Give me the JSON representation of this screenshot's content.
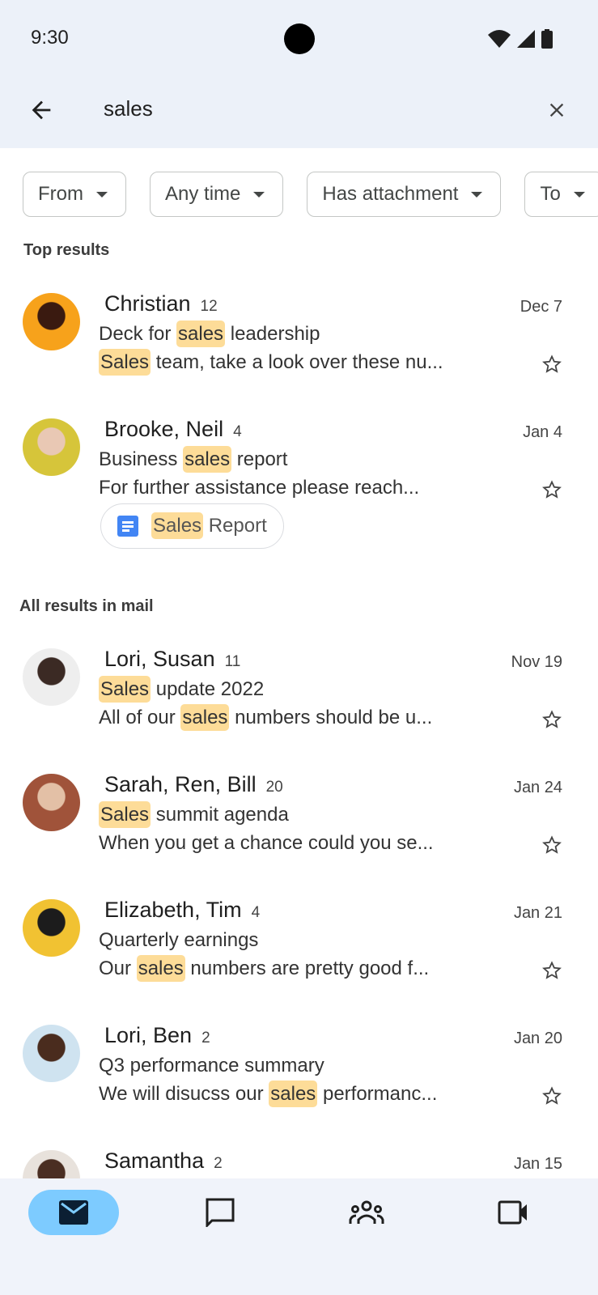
{
  "status_bar": {
    "time": "9:30"
  },
  "search": {
    "query": "sales"
  },
  "filters": [
    {
      "label": "From"
    },
    {
      "label": "Any time"
    },
    {
      "label": "Has attachment"
    },
    {
      "label": "To"
    }
  ],
  "sections": {
    "top": "Top results",
    "all": "All results in mail"
  },
  "highlight_color": "#fddc98",
  "top_results": [
    {
      "sender": "Christian",
      "count": "12",
      "date": "Dec 7",
      "avatar_colors": [
        "#f7a21b",
        "#3a1a10"
      ],
      "subject": [
        {
          "t": "Deck for "
        },
        {
          "t": "sales",
          "hl": true
        },
        {
          "t": " leadership"
        }
      ],
      "preview": [
        {
          "t": "Sales",
          "hl": true
        },
        {
          "t": " team, take a look over these nu..."
        }
      ]
    },
    {
      "sender": "Brooke, Neil",
      "count": "4",
      "date": "Jan 4",
      "avatar_colors": [
        "#d6c53a",
        "#e9c8b4"
      ],
      "subject": [
        {
          "t": "Business "
        },
        {
          "t": "sales",
          "hl": true
        },
        {
          "t": " report"
        }
      ],
      "preview": [
        {
          "t": "For further assistance please reach..."
        }
      ],
      "attachment": [
        {
          "t": "Sales",
          "hl": true
        },
        {
          "t": " Report"
        }
      ]
    }
  ],
  "all_results": [
    {
      "sender": "Lori, Susan",
      "count": "11",
      "date": "Nov 19",
      "avatar_colors": [
        "#eeeeee",
        "#3b2a24"
      ],
      "subject": [
        {
          "t": "Sales",
          "hl": true
        },
        {
          "t": " update 2022"
        }
      ],
      "preview": [
        {
          "t": "All of our "
        },
        {
          "t": "sales",
          "hl": true
        },
        {
          "t": " numbers should be u..."
        }
      ]
    },
    {
      "sender": "Sarah, Ren, Bill",
      "count": "20",
      "date": "Jan 24",
      "avatar_colors": [
        "#a0533a",
        "#e3c0a6"
      ],
      "subject": [
        {
          "t": "Sales",
          "hl": true
        },
        {
          "t": " summit agenda"
        }
      ],
      "preview": [
        {
          "t": "When you get a chance could you se..."
        }
      ]
    },
    {
      "sender": "Elizabeth, Tim",
      "count": "4",
      "date": "Jan 21",
      "avatar_colors": [
        "#f1c232",
        "#1c1c1c"
      ],
      "subject": [
        {
          "t": "Quarterly earnings"
        }
      ],
      "preview": [
        {
          "t": "Our "
        },
        {
          "t": "sales",
          "hl": true
        },
        {
          "t": " numbers are pretty good f..."
        }
      ]
    },
    {
      "sender": "Lori, Ben",
      "count": "2",
      "date": "Jan 20",
      "avatar_colors": [
        "#cfe3f0",
        "#4a2c1e"
      ],
      "subject": [
        {
          "t": "Q3 performance summary"
        }
      ],
      "preview": [
        {
          "t": "We will disucss our "
        },
        {
          "t": "sales",
          "hl": true
        },
        {
          "t": " performanc..."
        }
      ]
    },
    {
      "sender": "Samantha",
      "count": "2",
      "date": "Jan 15",
      "avatar_colors": [
        "#e8e2dc",
        "#4a2e22"
      ],
      "subject": [],
      "preview": []
    }
  ],
  "bottom_nav": [
    {
      "icon": "mail-icon",
      "active": true
    },
    {
      "icon": "chat-icon"
    },
    {
      "icon": "spaces-icon"
    },
    {
      "icon": "meet-icon"
    }
  ],
  "colors": {
    "header_bg": "#ecf1f9",
    "nav_active": "#7dcbff"
  }
}
